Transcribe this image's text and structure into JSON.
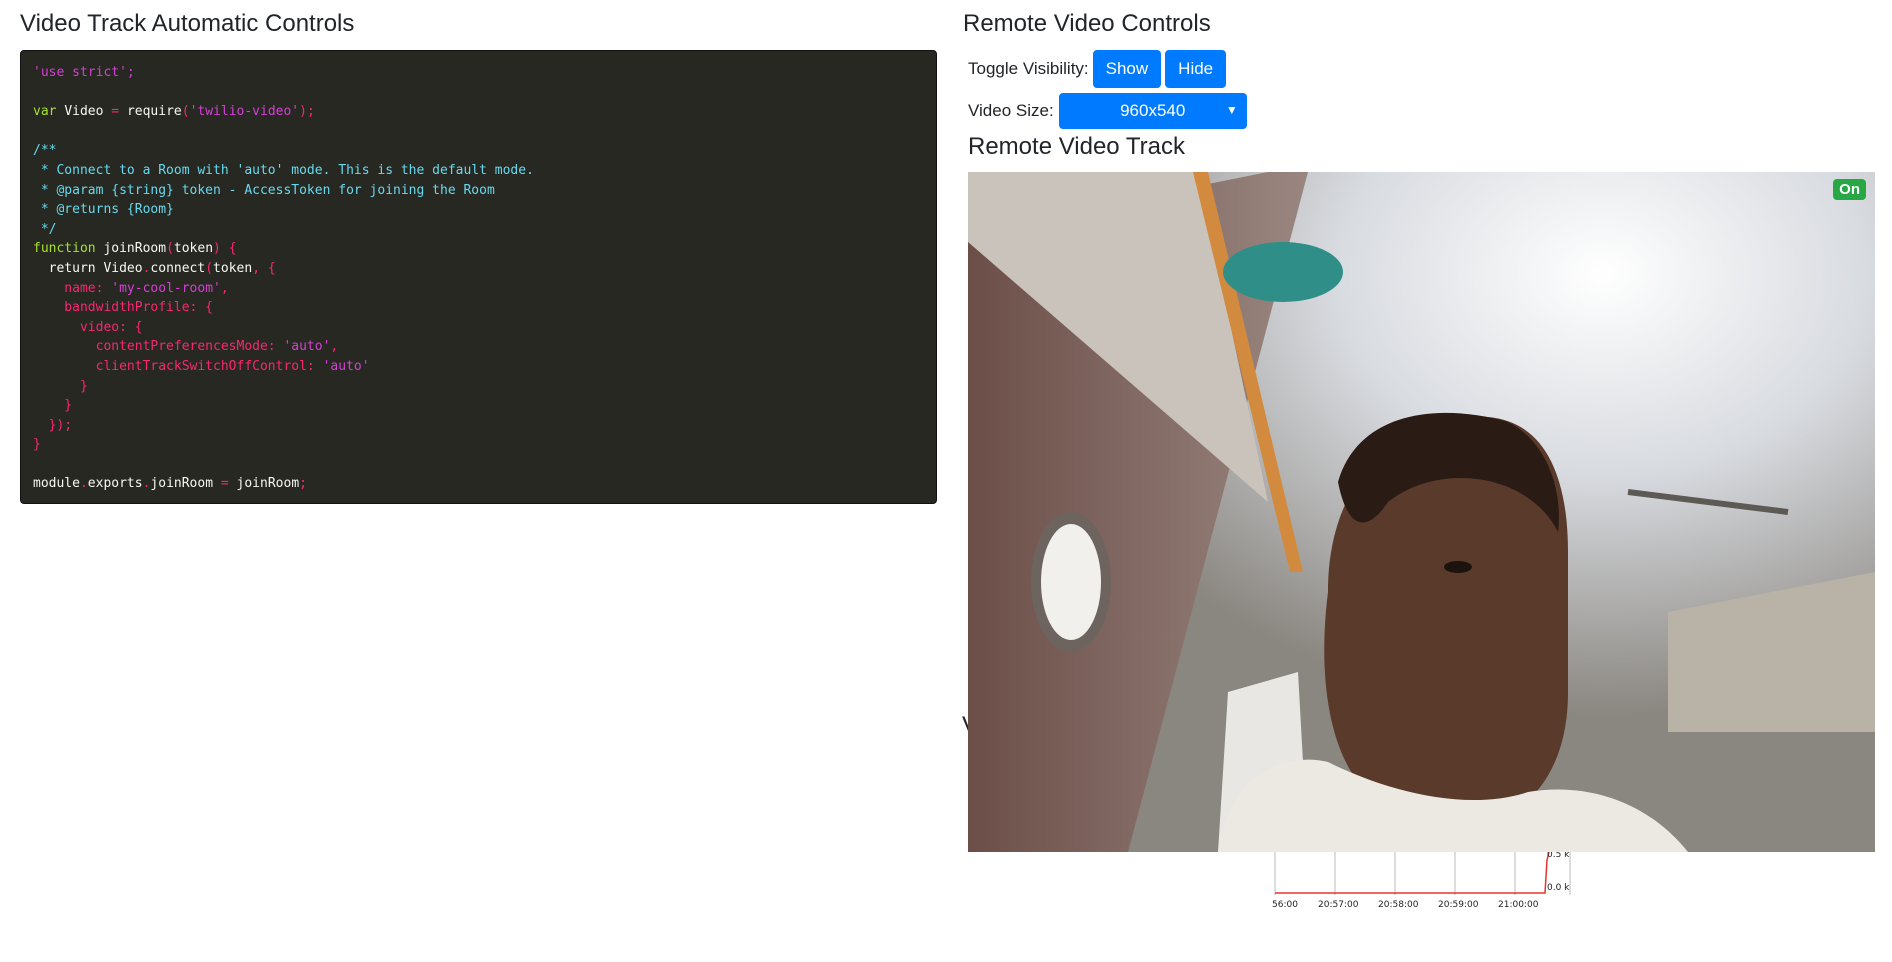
{
  "left": {
    "title": "Video Track Automatic Controls",
    "code_lines": [
      [
        [
          "str2",
          "'use strict';"
        ]
      ],
      [],
      [
        [
          "kw",
          "var "
        ],
        [
          "id",
          "Video "
        ],
        [
          "pn",
          "= "
        ],
        [
          "id",
          "require"
        ],
        [
          "pn",
          "("
        ],
        [
          "str2",
          "'twilio-video'"
        ],
        [
          "pn",
          ");"
        ]
      ],
      [],
      [
        [
          "cm",
          "/**"
        ]
      ],
      [
        [
          "cm",
          " * Connect to a Room with 'auto' mode. This is the default mode."
        ]
      ],
      [
        [
          "cm",
          " * @param {string} token - AccessToken for joining the Room"
        ]
      ],
      [
        [
          "cm",
          " * @returns {Room}"
        ]
      ],
      [
        [
          "cm",
          " */"
        ]
      ],
      [
        [
          "kw",
          "function "
        ],
        [
          "id",
          "joinRoom"
        ],
        [
          "pn",
          "("
        ],
        [
          "id",
          "token"
        ],
        [
          "pn",
          ") {"
        ]
      ],
      [
        [
          "id",
          "  return "
        ],
        [
          "id",
          "Video"
        ],
        [
          "pn",
          "."
        ],
        [
          "id",
          "connect"
        ],
        [
          "pn",
          "("
        ],
        [
          "id",
          "token"
        ],
        [
          "pn",
          ", {"
        ]
      ],
      [
        [
          "prop",
          "    name: "
        ],
        [
          "str2",
          "'my-cool-room'"
        ],
        [
          "pn",
          ","
        ]
      ],
      [
        [
          "prop",
          "    bandwidthProfile: {"
        ]
      ],
      [
        [
          "prop",
          "      video: {"
        ]
      ],
      [
        [
          "prop",
          "        contentPreferencesMode: "
        ],
        [
          "str2",
          "'auto'"
        ],
        [
          "pn",
          ","
        ]
      ],
      [
        [
          "prop",
          "        clientTrackSwitchOffControl: "
        ],
        [
          "str2",
          "'auto'"
        ]
      ],
      [
        [
          "pn",
          "      }"
        ]
      ],
      [
        [
          "pn",
          "    }"
        ]
      ],
      [
        [
          "pn",
          "  });"
        ]
      ],
      [
        [
          "pn",
          "}"
        ]
      ],
      [],
      [
        [
          "id",
          "module"
        ],
        [
          "pn",
          "."
        ],
        [
          "id",
          "exports"
        ],
        [
          "pn",
          "."
        ],
        [
          "id",
          "joinRoom "
        ],
        [
          "pn",
          "= "
        ],
        [
          "id",
          "joinRoom"
        ],
        [
          "pn",
          ";"
        ]
      ]
    ]
  },
  "right": {
    "title": "Remote Video Controls",
    "visibility_label": "Toggle Visibility:",
    "show_label": "Show",
    "hide_label": "Hide",
    "size_label": "Video Size:",
    "size_selected": "960x540",
    "track_title": "Remote Video Track",
    "status_badge": "On",
    "partial_heading": "V"
  },
  "chart": {
    "y_labels": [
      "0.5 k",
      "0.0 k"
    ],
    "x_labels": [
      "56:00",
      "20:57:00",
      "20:58:00",
      "20:59:00",
      "21:00:00"
    ]
  },
  "colors": {
    "accent": "#007bff",
    "badge": "#28a745",
    "code_bg": "#272822",
    "graph_line": "#e8322d"
  }
}
